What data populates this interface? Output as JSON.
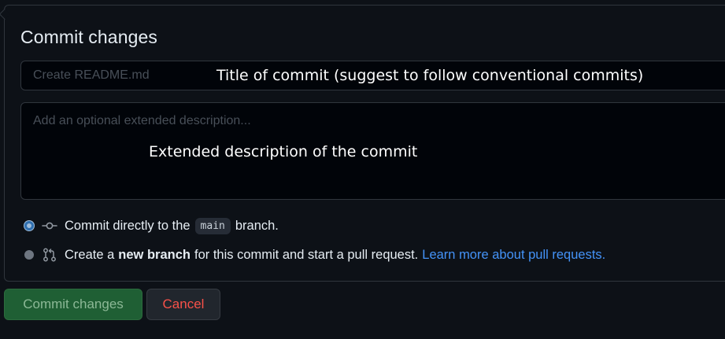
{
  "panel": {
    "title": "Commit changes"
  },
  "summary": {
    "placeholder": "Create README.md",
    "value": ""
  },
  "description": {
    "placeholder": "Add an optional extended description...",
    "value": ""
  },
  "annotations": {
    "title_note": "Title of commit (suggest to follow conventional commits)",
    "description_note": "Extended description of the commit"
  },
  "options": {
    "direct": {
      "checked": true,
      "prefix": "Commit directly to the",
      "branch": "main",
      "suffix": "branch.",
      "icon": "git-commit-icon"
    },
    "new_branch": {
      "checked": false,
      "prefix": "Create a",
      "bold": "new branch",
      "suffix": "for this commit and start a pull request.",
      "link": "Learn more about pull requests.",
      "icon": "git-pull-request-icon"
    }
  },
  "buttons": {
    "commit": "Commit changes",
    "cancel": "Cancel"
  },
  "colors": {
    "background": "#0d1117",
    "border": "#30363d",
    "commit_button_bg": "#1f5f34",
    "cancel_text": "#f85149",
    "link": "#4493f8"
  }
}
